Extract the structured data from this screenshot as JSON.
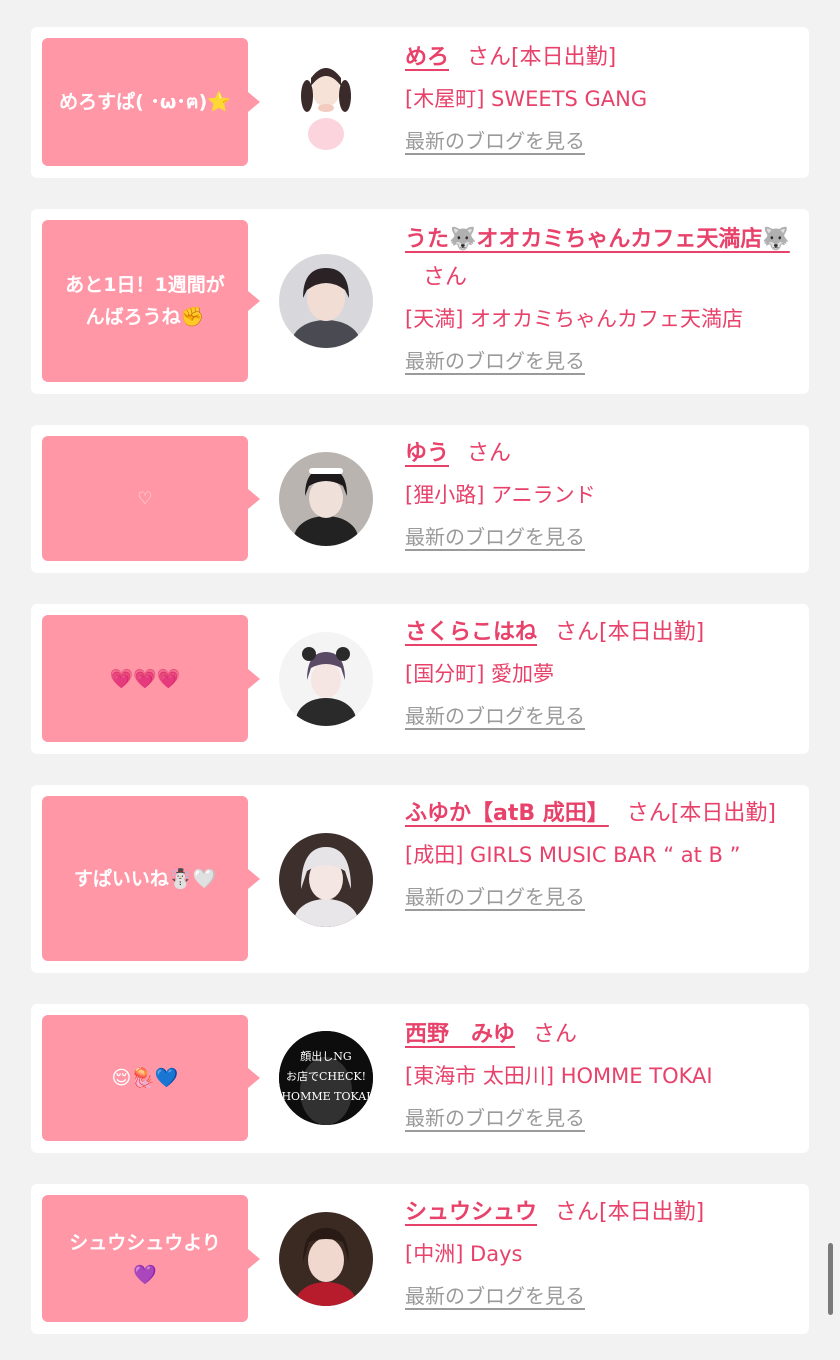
{
  "colors": {
    "accent": "#e8416a",
    "bubble": "#ff97a6",
    "background": "#f2f2f2",
    "link_gray": "#9a9a9a"
  },
  "entries": [
    {
      "message": "めろすぱ( ･ω･ฅ)⭐️",
      "name": "めろ",
      "suffix": "さん[本日出勤]",
      "shop": "[木屋町] SWEETS GANG",
      "blog_link": "最新のブログを見る"
    },
    {
      "message": "あと1日！1週間が\nんばろうね✊",
      "name": "うた🐺オオカミちゃんカフェ天満店🐺",
      "suffix": "さん",
      "shop": "[天満] オオカミちゃんカフェ天満店",
      "blog_link": "最新のブログを見る"
    },
    {
      "message": "♡",
      "name": "ゆう",
      "suffix": "さん",
      "shop": "[狸小路] アニランド",
      "blog_link": "最新のブログを見る"
    },
    {
      "message": "💗💗💗",
      "name": "さくらこはね",
      "suffix": "さん[本日出勤]",
      "shop": "[国分町] 愛加夢",
      "blog_link": "最新のブログを見る"
    },
    {
      "message": "すぱいいね☃️🤍",
      "name": "ふゆか【atB 成田】",
      "suffix": "さん[本日出勤]",
      "shop": "[成田] GIRLS MUSIC BAR “ at B ”",
      "blog_link": "最新のブログを見る"
    },
    {
      "message": "😌🪼💙",
      "name": "西野　みゆ",
      "suffix": "さん",
      "shop": "[東海市 太田川] HOMME TOKAI",
      "blog_link": "最新のブログを見る",
      "avatar_text": "顔出しNG\nお店でCHECK!\nHOMME TOKAI"
    },
    {
      "message": "シュウシュウより\n💜",
      "name": "シュウシュウ",
      "suffix": "さん[本日出勤]",
      "shop": "[中洲] Days",
      "blog_link": "最新のブログを見る"
    }
  ]
}
